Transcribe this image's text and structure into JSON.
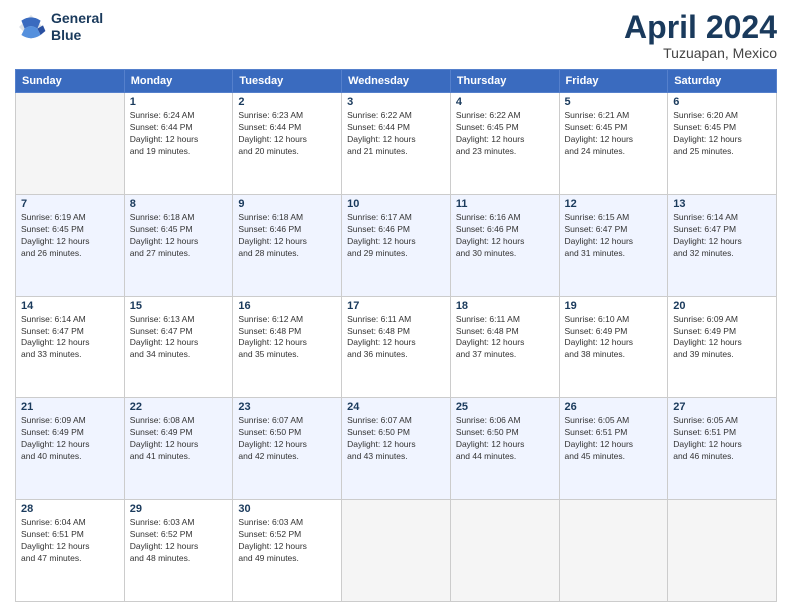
{
  "logo": {
    "line1": "General",
    "line2": "Blue"
  },
  "title": "April 2024",
  "subtitle": "Tuzuapan, Mexico",
  "days_header": [
    "Sunday",
    "Monday",
    "Tuesday",
    "Wednesday",
    "Thursday",
    "Friday",
    "Saturday"
  ],
  "weeks": [
    [
      {
        "day": "",
        "sunrise": "",
        "sunset": "",
        "daylight": ""
      },
      {
        "day": "1",
        "sunrise": "Sunrise: 6:24 AM",
        "sunset": "Sunset: 6:44 PM",
        "daylight": "Daylight: 12 hours and 19 minutes."
      },
      {
        "day": "2",
        "sunrise": "Sunrise: 6:23 AM",
        "sunset": "Sunset: 6:44 PM",
        "daylight": "Daylight: 12 hours and 20 minutes."
      },
      {
        "day": "3",
        "sunrise": "Sunrise: 6:22 AM",
        "sunset": "Sunset: 6:44 PM",
        "daylight": "Daylight: 12 hours and 21 minutes."
      },
      {
        "day": "4",
        "sunrise": "Sunrise: 6:22 AM",
        "sunset": "Sunset: 6:45 PM",
        "daylight": "Daylight: 12 hours and 23 minutes."
      },
      {
        "day": "5",
        "sunrise": "Sunrise: 6:21 AM",
        "sunset": "Sunset: 6:45 PM",
        "daylight": "Daylight: 12 hours and 24 minutes."
      },
      {
        "day": "6",
        "sunrise": "Sunrise: 6:20 AM",
        "sunset": "Sunset: 6:45 PM",
        "daylight": "Daylight: 12 hours and 25 minutes."
      }
    ],
    [
      {
        "day": "7",
        "sunrise": "Sunrise: 6:19 AM",
        "sunset": "Sunset: 6:45 PM",
        "daylight": "Daylight: 12 hours and 26 minutes."
      },
      {
        "day": "8",
        "sunrise": "Sunrise: 6:18 AM",
        "sunset": "Sunset: 6:45 PM",
        "daylight": "Daylight: 12 hours and 27 minutes."
      },
      {
        "day": "9",
        "sunrise": "Sunrise: 6:18 AM",
        "sunset": "Sunset: 6:46 PM",
        "daylight": "Daylight: 12 hours and 28 minutes."
      },
      {
        "day": "10",
        "sunrise": "Sunrise: 6:17 AM",
        "sunset": "Sunset: 6:46 PM",
        "daylight": "Daylight: 12 hours and 29 minutes."
      },
      {
        "day": "11",
        "sunrise": "Sunrise: 6:16 AM",
        "sunset": "Sunset: 6:46 PM",
        "daylight": "Daylight: 12 hours and 30 minutes."
      },
      {
        "day": "12",
        "sunrise": "Sunrise: 6:15 AM",
        "sunset": "Sunset: 6:47 PM",
        "daylight": "Daylight: 12 hours and 31 minutes."
      },
      {
        "day": "13",
        "sunrise": "Sunrise: 6:14 AM",
        "sunset": "Sunset: 6:47 PM",
        "daylight": "Daylight: 12 hours and 32 minutes."
      }
    ],
    [
      {
        "day": "14",
        "sunrise": "Sunrise: 6:14 AM",
        "sunset": "Sunset: 6:47 PM",
        "daylight": "Daylight: 12 hours and 33 minutes."
      },
      {
        "day": "15",
        "sunrise": "Sunrise: 6:13 AM",
        "sunset": "Sunset: 6:47 PM",
        "daylight": "Daylight: 12 hours and 34 minutes."
      },
      {
        "day": "16",
        "sunrise": "Sunrise: 6:12 AM",
        "sunset": "Sunset: 6:48 PM",
        "daylight": "Daylight: 12 hours and 35 minutes."
      },
      {
        "day": "17",
        "sunrise": "Sunrise: 6:11 AM",
        "sunset": "Sunset: 6:48 PM",
        "daylight": "Daylight: 12 hours and 36 minutes."
      },
      {
        "day": "18",
        "sunrise": "Sunrise: 6:11 AM",
        "sunset": "Sunset: 6:48 PM",
        "daylight": "Daylight: 12 hours and 37 minutes."
      },
      {
        "day": "19",
        "sunrise": "Sunrise: 6:10 AM",
        "sunset": "Sunset: 6:49 PM",
        "daylight": "Daylight: 12 hours and 38 minutes."
      },
      {
        "day": "20",
        "sunrise": "Sunrise: 6:09 AM",
        "sunset": "Sunset: 6:49 PM",
        "daylight": "Daylight: 12 hours and 39 minutes."
      }
    ],
    [
      {
        "day": "21",
        "sunrise": "Sunrise: 6:09 AM",
        "sunset": "Sunset: 6:49 PM",
        "daylight": "Daylight: 12 hours and 40 minutes."
      },
      {
        "day": "22",
        "sunrise": "Sunrise: 6:08 AM",
        "sunset": "Sunset: 6:49 PM",
        "daylight": "Daylight: 12 hours and 41 minutes."
      },
      {
        "day": "23",
        "sunrise": "Sunrise: 6:07 AM",
        "sunset": "Sunset: 6:50 PM",
        "daylight": "Daylight: 12 hours and 42 minutes."
      },
      {
        "day": "24",
        "sunrise": "Sunrise: 6:07 AM",
        "sunset": "Sunset: 6:50 PM",
        "daylight": "Daylight: 12 hours and 43 minutes."
      },
      {
        "day": "25",
        "sunrise": "Sunrise: 6:06 AM",
        "sunset": "Sunset: 6:50 PM",
        "daylight": "Daylight: 12 hours and 44 minutes."
      },
      {
        "day": "26",
        "sunrise": "Sunrise: 6:05 AM",
        "sunset": "Sunset: 6:51 PM",
        "daylight": "Daylight: 12 hours and 45 minutes."
      },
      {
        "day": "27",
        "sunrise": "Sunrise: 6:05 AM",
        "sunset": "Sunset: 6:51 PM",
        "daylight": "Daylight: 12 hours and 46 minutes."
      }
    ],
    [
      {
        "day": "28",
        "sunrise": "Sunrise: 6:04 AM",
        "sunset": "Sunset: 6:51 PM",
        "daylight": "Daylight: 12 hours and 47 minutes."
      },
      {
        "day": "29",
        "sunrise": "Sunrise: 6:03 AM",
        "sunset": "Sunset: 6:52 PM",
        "daylight": "Daylight: 12 hours and 48 minutes."
      },
      {
        "day": "30",
        "sunrise": "Sunrise: 6:03 AM",
        "sunset": "Sunset: 6:52 PM",
        "daylight": "Daylight: 12 hours and 49 minutes."
      },
      {
        "day": "",
        "sunrise": "",
        "sunset": "",
        "daylight": ""
      },
      {
        "day": "",
        "sunrise": "",
        "sunset": "",
        "daylight": ""
      },
      {
        "day": "",
        "sunrise": "",
        "sunset": "",
        "daylight": ""
      },
      {
        "day": "",
        "sunrise": "",
        "sunset": "",
        "daylight": ""
      }
    ]
  ]
}
